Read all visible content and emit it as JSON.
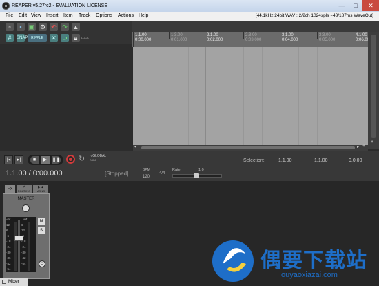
{
  "window": {
    "title": "REAPER v5.27rc2 - EVALUATION LICENSE",
    "minimize_label": "—",
    "maximize_label": "□",
    "close_label": "✕"
  },
  "menu": {
    "items": [
      "File",
      "Edit",
      "View",
      "Insert",
      "Item",
      "Track",
      "Options",
      "Actions",
      "Help"
    ],
    "status": "[44.1kHz 24bit WAV : 2/2ch 1024spls ~43/187ms WaveOut]"
  },
  "toolbar": {
    "icons": [
      "new-project-icon",
      "open-project-icon",
      "save-project-icon",
      "project-settings-icon",
      "undo-icon",
      "redo-icon",
      "metronome-icon",
      "grid-snap-icon",
      "ripple-edit-icon",
      "auto-crossfade-icon",
      "envelope-points-icon",
      "locking-icon"
    ],
    "snap_label": "SNAP",
    "ripple_label": "RIPPLE",
    "lock_label": "LOCK"
  },
  "ruler": {
    "markers": [
      {
        "bar": "1.1.00",
        "time": "0:00.000",
        "major": true
      },
      {
        "bar": "1.3.00",
        "time": "0:01.000",
        "major": false
      },
      {
        "bar": "2.1.00",
        "time": "0:02.000",
        "major": true
      },
      {
        "bar": "2.3.00",
        "time": "0:03.000",
        "major": false
      },
      {
        "bar": "3.1.00",
        "time": "0:04.000",
        "major": true
      },
      {
        "bar": "3.3.00",
        "time": "0:05.000",
        "major": false
      },
      {
        "bar": "4.1.00",
        "time": "0:06.000",
        "major": true
      }
    ]
  },
  "transport": {
    "global_label": "GLOBAL",
    "auto_label": "none",
    "position": "1.1.00 / 0:00.000",
    "state": "[Stopped]",
    "bpm_label": "BPM",
    "bpm": "120",
    "time_signature": "4/4",
    "rate_label": "Rate:",
    "rate_value": "1.0",
    "selection_label": "Selection:",
    "selection_start": "1.1.00",
    "selection_end": "1.1.00",
    "selection_length": "0.0.00"
  },
  "mixer": {
    "routing_label": "ROUTING",
    "mono_label": "MONO",
    "master_label": "MASTER",
    "mute_label": "M",
    "solo_label": "S",
    "peak_left": "-inf",
    "peak_right": "-inf",
    "db_scale_left": [
      "12",
      "6",
      "-6",
      "-18",
      "-24",
      "-30",
      "-36",
      "-42",
      "-54"
    ],
    "db_scale_right": [
      "6",
      "12",
      "-6",
      "-18",
      "-24",
      "-30",
      "-42",
      "-54"
    ],
    "tab_label": "Mixer"
  },
  "watermark": {
    "title": "偶要下载站",
    "url": "ouyaoxiazai.com"
  },
  "colors": {
    "arrange": "#a3a3a3",
    "record": "#d23b3b",
    "watermark_blue": "#1e6ec8"
  }
}
